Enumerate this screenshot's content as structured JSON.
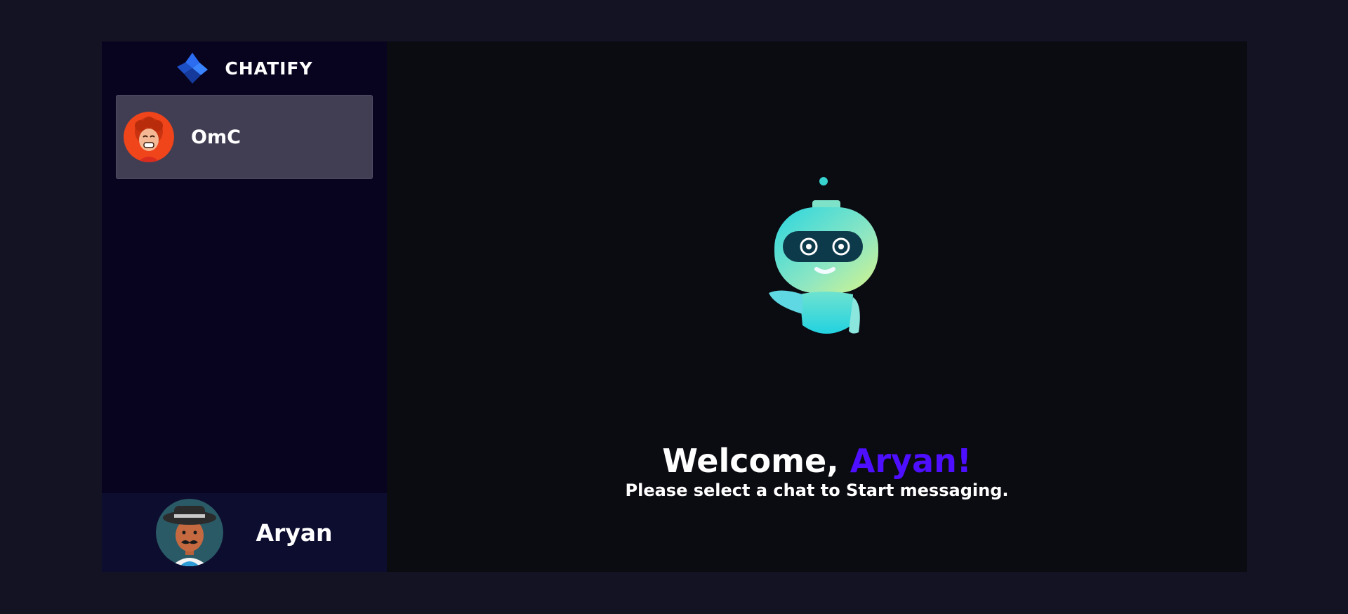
{
  "brand": {
    "name": "CHATIFY",
    "logo_icon": "chatify-logo-icon"
  },
  "contacts": [
    {
      "name": "OmC",
      "avatar_icon": "curly-hair-avatar-icon",
      "selected": true
    }
  ],
  "current_user": {
    "name": "Aryan",
    "avatar_icon": "hat-mustache-avatar-icon"
  },
  "welcome": {
    "greeting": "Welcome, ",
    "username": "Aryan!",
    "message": "Please select a chat to Start messaging."
  },
  "colors": {
    "background": "#131324",
    "sidebar": "#080420",
    "contact_selected": "#413e54",
    "current_user_bar": "#0d0d30",
    "main": "#0b0b12",
    "accent": "#4e0eff"
  }
}
